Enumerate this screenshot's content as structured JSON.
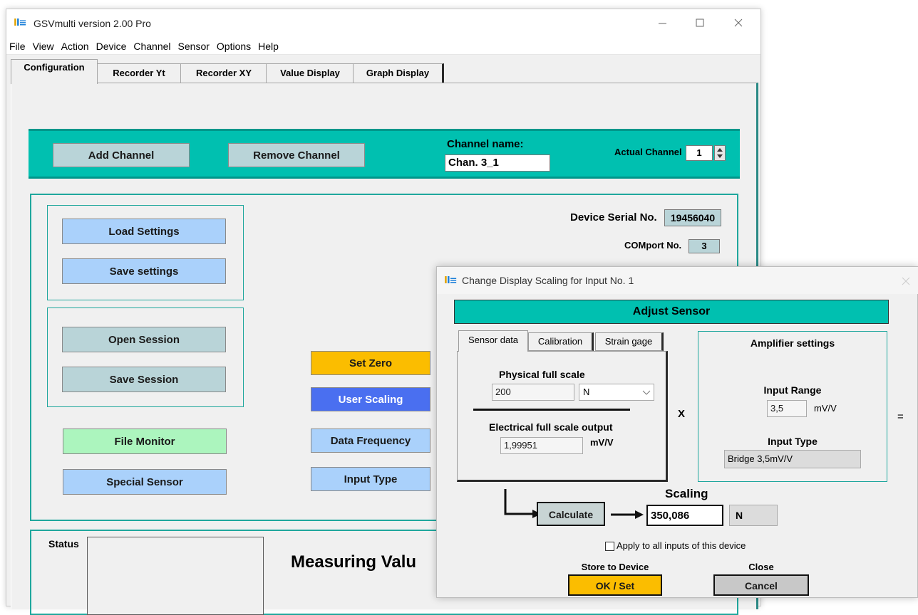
{
  "window": {
    "title": "GSVmulti version 2.00 Pro",
    "logo": "ME",
    "menu": [
      "File",
      "View",
      "Action",
      "Device",
      "Channel",
      "Sensor",
      "Options",
      "Help"
    ],
    "tabs": [
      "Configuration",
      "Recorder Yt",
      "Recorder XY",
      "Value Display",
      "Graph Display"
    ],
    "active_tab": "Configuration"
  },
  "channel_bar": {
    "add_channel": "Add Channel",
    "remove_channel": "Remove Channel",
    "channel_name_label": "Channel name:",
    "channel_name_value": "Chan. 3_1",
    "actual_channel_label": "Actual Channel",
    "actual_channel_value": "1"
  },
  "device": {
    "serial_label": "Device Serial No.",
    "serial_value": "19456040",
    "comport_label": "COMport No.",
    "comport_value": "3"
  },
  "buttons": {
    "load_settings": "Load Settings",
    "save_settings": "Save settings",
    "open_session": "Open Session",
    "save_session": "Save Session",
    "file_monitor": "File Monitor",
    "special_sensor": "Special Sensor",
    "set_zero": "Set Zero",
    "user_scaling": "User Scaling",
    "data_frequency": "Data Frequency",
    "input_type": "Input Type"
  },
  "status": {
    "label": "Status",
    "measuring_values": "Measuring Valu"
  },
  "dialog": {
    "title": "Change Display Scaling for Input No. 1",
    "logo": "ME",
    "header": "Adjust Sensor",
    "tabs": [
      "Sensor data",
      "Calibration",
      "Strain gage"
    ],
    "physical_full_scale_label": "Physical full scale",
    "physical_full_scale_value": "200",
    "unit_select": "N",
    "electrical_label": "Electrical full scale output",
    "electrical_value": "1,99951",
    "electrical_unit": "mV/V",
    "multiply": "X",
    "equals": "=",
    "amplifier_title": "Amplifier settings",
    "input_range_label": "Input Range",
    "input_range_value": "3,5",
    "input_range_unit": "mV/V",
    "input_type_label": "Input Type",
    "input_type_value": "Bridge 3,5mV/V",
    "calculate": "Calculate",
    "scaling_label": "Scaling",
    "scaling_value": "350,086",
    "scaling_unit": "N",
    "apply_all": "Apply to all inputs of this device",
    "apply_all_checked": false,
    "store_label": "Store to Device",
    "ok_set": "OK / Set",
    "close_label": "Close",
    "cancel": "Cancel"
  },
  "colors": {
    "teal": "#00c0b0",
    "button_grey": "#b9d4d8",
    "button_blue": "#aad1fb",
    "button_green": "#acf5be",
    "button_orange": "#fbbd00",
    "button_royal": "#4a6ff0"
  }
}
